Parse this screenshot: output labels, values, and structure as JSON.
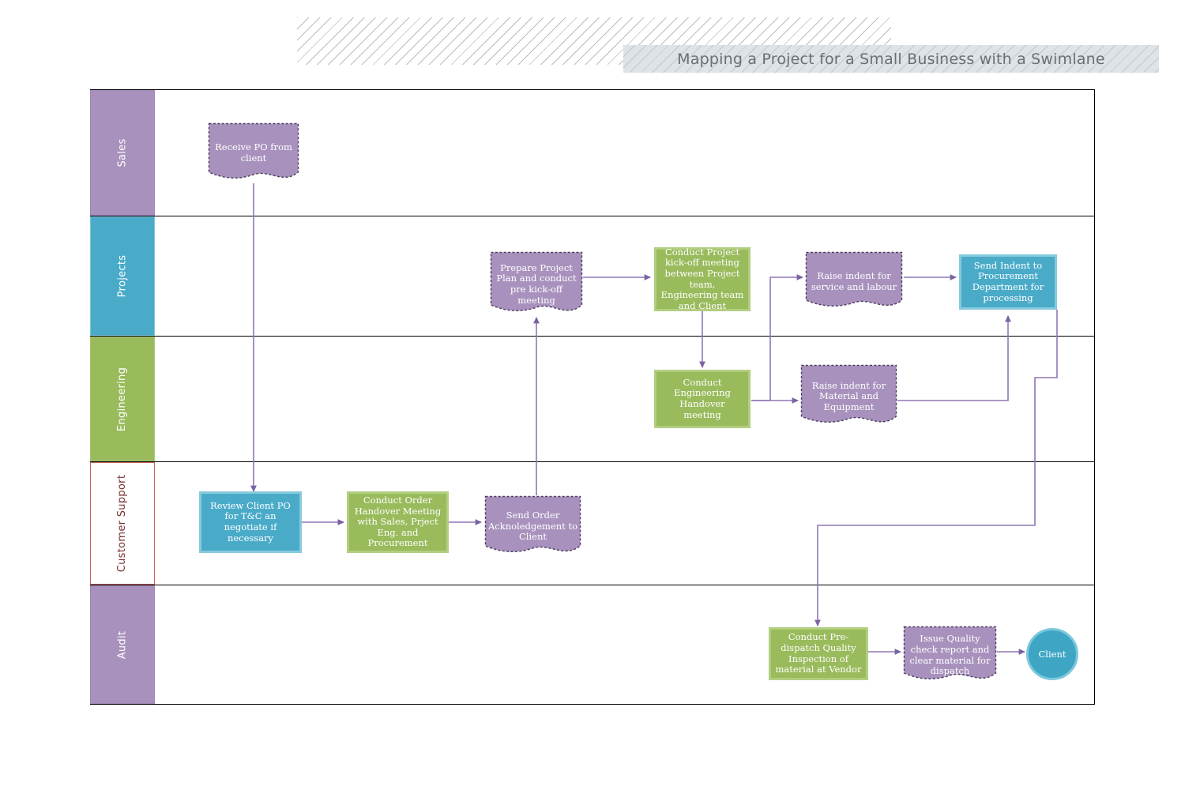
{
  "title": "Mapping a Project for a Small Business with a Swimlane",
  "colors": {
    "purple": "#a892bd",
    "blue": "#4aabc9",
    "green": "#99bb5c",
    "white": "#ffffff",
    "customer_support_border": "#c9605c",
    "customer_support_text": "#77302e",
    "connector": "#7b62a3",
    "title_text": "#6b6f72"
  },
  "lanes": [
    {
      "label": "Sales",
      "style": "purple"
    },
    {
      "label": "Projects",
      "style": "blue"
    },
    {
      "label": "Engineering",
      "style": "green"
    },
    {
      "label": "Customer Support",
      "style": "white"
    },
    {
      "label": "Audit",
      "style": "purple"
    }
  ],
  "nodes": [
    {
      "id": "receive-po",
      "label": "Receive PO from client",
      "lane": "Sales",
      "shape": "document",
      "color": "purple"
    },
    {
      "id": "prepare-plan",
      "label": "Prepare Project Plan and conduct pre kick-off meeting",
      "lane": "Projects",
      "shape": "document",
      "color": "purple"
    },
    {
      "id": "kickoff-meeting",
      "label": "Conduct Project kick-off meeting between Project team, Engineering team and Client",
      "lane": "Projects",
      "shape": "rectangle",
      "color": "green"
    },
    {
      "id": "indent-service",
      "label": "Raise indent for service and labour",
      "lane": "Projects",
      "shape": "document",
      "color": "purple"
    },
    {
      "id": "send-indent",
      "label": "Send Indent to Procurement Department for processing",
      "lane": "Projects",
      "shape": "rectangle",
      "color": "blue"
    },
    {
      "id": "eng-handover",
      "label": "Conduct Engineering Handover meeting",
      "lane": "Engineering",
      "shape": "rectangle",
      "color": "green"
    },
    {
      "id": "indent-material",
      "label": "Raise indent for Material and Equipment",
      "lane": "Engineering",
      "shape": "document",
      "color": "purple"
    },
    {
      "id": "review-po",
      "label": "Review Client PO for T&C an negotiate if necessary",
      "lane": "Customer Support",
      "shape": "rectangle",
      "color": "blue"
    },
    {
      "id": "order-handover",
      "label": "Conduct Order Handover Meeting with Sales, Prject Eng. and Procurement",
      "lane": "Customer Support",
      "shape": "rectangle",
      "color": "green"
    },
    {
      "id": "send-ack",
      "label": "Send Order Acknoledgement to Client",
      "lane": "Customer Support",
      "shape": "document",
      "color": "purple"
    },
    {
      "id": "pre-dispatch",
      "label": "Conduct Pre-dispatch Quality Inspection of material at Vendor",
      "lane": "Audit",
      "shape": "rectangle",
      "color": "green"
    },
    {
      "id": "quality-report",
      "label": "Issue Quality check report and clear material for dispatch",
      "lane": "Audit",
      "shape": "document",
      "color": "purple"
    },
    {
      "id": "client-end",
      "label": "Client",
      "lane": "Audit",
      "shape": "circle",
      "color": "blue"
    }
  ],
  "connections": [
    {
      "from": "receive-po",
      "to": "review-po"
    },
    {
      "from": "review-po",
      "to": "order-handover"
    },
    {
      "from": "order-handover",
      "to": "send-ack"
    },
    {
      "from": "send-ack",
      "to": "prepare-plan"
    },
    {
      "from": "prepare-plan",
      "to": "kickoff-meeting"
    },
    {
      "from": "kickoff-meeting",
      "to": "eng-handover"
    },
    {
      "from": "eng-handover",
      "to": "indent-service"
    },
    {
      "from": "eng-handover",
      "to": "indent-material"
    },
    {
      "from": "indent-service",
      "to": "send-indent"
    },
    {
      "from": "indent-material",
      "to": "send-indent"
    },
    {
      "from": "send-indent",
      "to": "pre-dispatch"
    },
    {
      "from": "pre-dispatch",
      "to": "quality-report"
    },
    {
      "from": "quality-report",
      "to": "client-end"
    }
  ]
}
